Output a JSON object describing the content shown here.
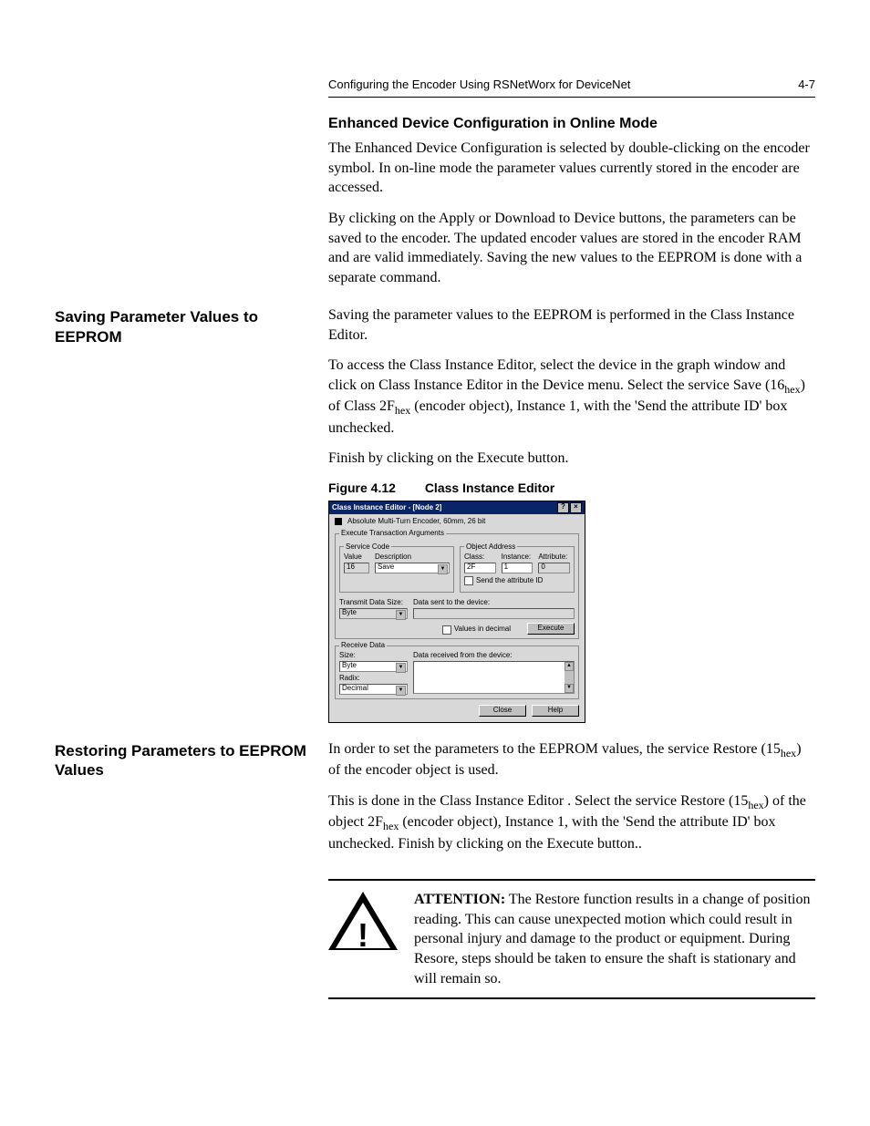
{
  "header": {
    "title": "Configuring the Encoder Using RSNetWorx for DeviceNet",
    "page": "4-7"
  },
  "intro": {
    "heading": "Enhanced Device Configuration in Online Mode",
    "p1": "The Enhanced Device Configuration is selected by double-clicking on the encoder symbol. In on-line mode the parameter values currently stored in the encoder are accessed.",
    "p2": "By clicking on the Apply or Download to Device buttons, the parameters can be saved to the encoder. The updated encoder values are stored in the encoder RAM and are valid immediately. Saving the new values to the EEPROM is done with a separate command."
  },
  "saving": {
    "side_heading": "Saving Parameter Values to EEPROM",
    "p1": "Saving the parameter values to the EEPROM is performed in the Class Instance Editor.",
    "p2a": "To access the Class Instance Editor, select the device in the graph window and click on Class Instance Editor in the Device menu. Select the service Save (16",
    "p2b": ") of Class 2F",
    "p2c": " (encoder object), Instance 1, with the 'Send the attribute ID' box unchecked.",
    "p3": "Finish by clicking on the Execute button.",
    "hex": "hex"
  },
  "figure": {
    "number": "Figure 4.12",
    "title": "Class Instance Editor",
    "dialog_title": "Class Instance Editor - [Node 2]",
    "device_name": "Absolute Multi-Turn Encoder, 60mm, 26 bit",
    "group_exec": "Execute Transaction Arguments",
    "group_service": "Service Code",
    "lbl_value": "Value",
    "lbl_description": "Description",
    "value_field": "16",
    "desc_field": "Save",
    "group_object": "Object Address",
    "lbl_class": "Class:",
    "lbl_instance": "Instance:",
    "lbl_attribute": "Attribute:",
    "class_val": "2F",
    "instance_val": "1",
    "attribute_val": "0",
    "chk_send_attr": "Send the attribute ID",
    "lbl_tx_size": "Transmit Data Size:",
    "tx_size_val": "Byte",
    "lbl_data_sent": "Data sent to the device:",
    "chk_values_dec": "Values in decimal",
    "btn_execute": "Execute",
    "group_receive": "Receive Data",
    "lbl_size": "Size:",
    "rx_size_val": "Byte",
    "lbl_radix": "Radix:",
    "rx_radix_val": "Decimal",
    "lbl_data_recv": "Data received from the device:",
    "btn_close": "Close",
    "btn_help": "Help"
  },
  "restoring": {
    "side_heading": "Restoring Parameters to EEPROM Values",
    "p1a": "In order to set the parameters to the EEPROM values, the service Restore (15",
    "p1b": ") of the encoder object is used.",
    "p2a": "This is done in the Class Instance Editor . Select the service Restore (15",
    "p2b": ") of the object 2F",
    "p2c": " (encoder object), Instance 1, with the 'Send the attribute ID' box unchecked. Finish by clicking on the Execute button..",
    "hex": "hex"
  },
  "attention": {
    "lead": "ATTENTION:",
    "body": "  The Restore function results in a change of position reading.  This can cause unexpected motion which could result in personal injury and damage to the product or equipment. During Resore, steps should be taken to ensure the shaft is stationary and will remain so."
  }
}
